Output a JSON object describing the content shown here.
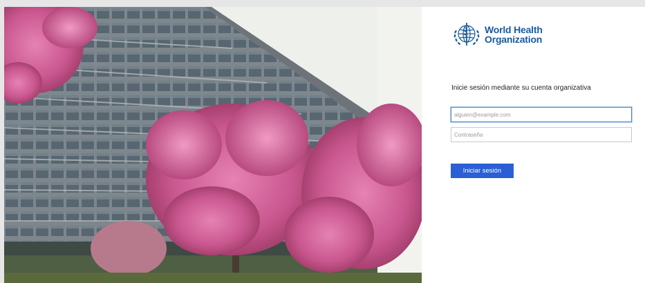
{
  "brand": {
    "name_line1": "World Health",
    "name_line2": "Organization",
    "logo_icon": "who-emblem-icon",
    "color": "#1a5a9c"
  },
  "signin": {
    "heading": "Inicie sesión mediante su cuenta organizativa",
    "email": {
      "value": "",
      "placeholder": "alguien@example.com"
    },
    "password": {
      "value": "",
      "placeholder": "Contraseña"
    },
    "submit_label": "Iniciar sesión",
    "accent_color": "#2a5fd5"
  }
}
